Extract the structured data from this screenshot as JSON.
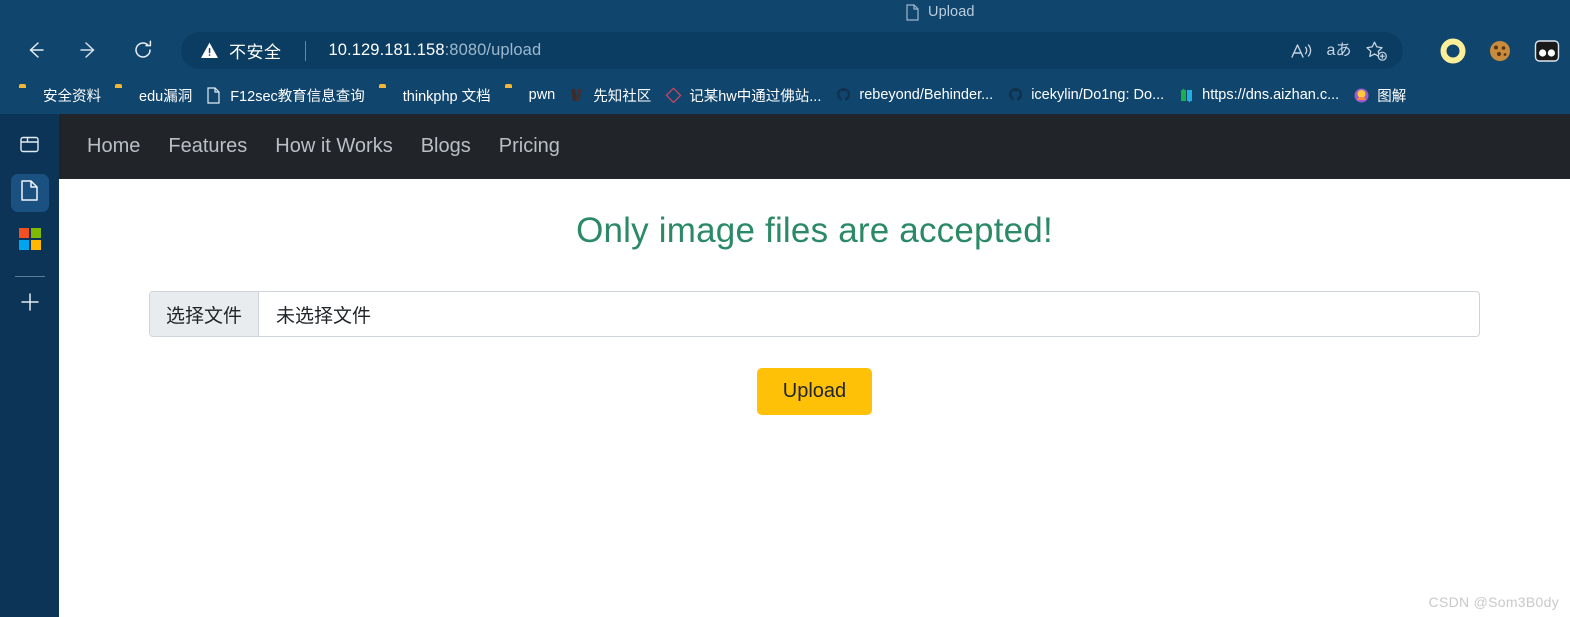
{
  "browser": {
    "tab": {
      "title": "Upload",
      "favicon_icon": "document-icon"
    },
    "nav": {
      "back_icon": "arrow-left-icon",
      "forward_icon": "arrow-right-icon",
      "reload_icon": "reload-icon"
    },
    "omnibox": {
      "security_icon": "warning-triangle-icon",
      "security_label": "不安全",
      "url_host": "10.129.181.158",
      "url_rest": ":8080/upload",
      "actions": [
        {
          "name": "read-aloud-icon",
          "label": "A"
        },
        {
          "name": "translate-icon",
          "label": "aあ"
        },
        {
          "name": "add-favorite-icon",
          "label": "star-plus"
        }
      ]
    },
    "extensions": [
      {
        "name": "ring-extension-icon",
        "color": "#ffe082"
      },
      {
        "name": "cookie-extension-icon",
        "color": "#c88a3d"
      },
      {
        "name": "goggles-extension-icon",
        "color": "#ffffff"
      }
    ],
    "bookmarks": [
      {
        "label": "安全资料",
        "icon": "folder-icon"
      },
      {
        "label": "edu漏洞",
        "icon": "folder-icon"
      },
      {
        "label": "F12sec教育信息查询",
        "icon": "page-icon"
      },
      {
        "label": "thinkphp 文档",
        "icon": "folder-icon"
      },
      {
        "label": "pwn",
        "icon": "folder-icon"
      },
      {
        "label": "先知社区",
        "icon": "xianzhi-icon"
      },
      {
        "label": "记某hw中通过佛站...",
        "icon": "diamond-icon"
      },
      {
        "label": "rebeyond/Behinder...",
        "icon": "github-icon"
      },
      {
        "label": "icekylin/Do1ng: Do...",
        "icon": "github-icon"
      },
      {
        "label": "https://dns.aizhan.c...",
        "icon": "aizhan-icon"
      },
      {
        "label": "图解",
        "icon": "tujie-icon"
      }
    ]
  },
  "sidebar": {
    "items": [
      {
        "name": "browser-essentials-icon",
        "active": false
      },
      {
        "name": "document-page-icon",
        "active": true
      },
      {
        "name": "microsoft-logo-icon",
        "active": false
      },
      {
        "name": "add-sidebar-app-icon",
        "active": false
      }
    ]
  },
  "site": {
    "nav": {
      "items": [
        {
          "label": "Home"
        },
        {
          "label": "Features"
        },
        {
          "label": "How it Works"
        },
        {
          "label": "Blogs"
        },
        {
          "label": "Pricing"
        }
      ]
    },
    "headline": "Only image files are accepted!",
    "headline_color": "#2b8a65",
    "file_input": {
      "button_label": "选择文件",
      "file_name": "未选择文件"
    },
    "upload_button": {
      "label": "Upload",
      "color": "#ffc107"
    }
  },
  "watermark": "CSDN @Som3B0dy"
}
